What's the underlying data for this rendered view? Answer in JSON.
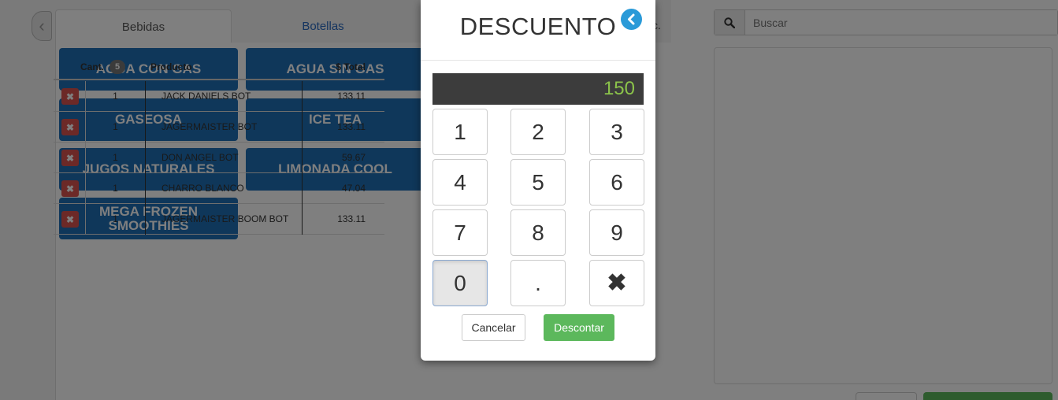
{
  "colors": {
    "product_button": "#1f6eb5",
    "delete_button": "#d9534f",
    "confirm_button": "#5cb85c",
    "display_text": "#8bc34a",
    "back_button": "#2a9ad8"
  },
  "tabs": [
    {
      "label": "Bebidas",
      "active": true
    },
    {
      "label": "Botellas",
      "active": false
    }
  ],
  "tab_overflow": "c.",
  "products": [
    {
      "label": "AGUA CON GAS"
    },
    {
      "label": "AGUA SIN GAS"
    },
    {
      "label": "GASEOSA"
    },
    {
      "label": "ICE TEA"
    },
    {
      "label": "JUGOS NATURALES"
    },
    {
      "label": "LIMONADA COOL"
    },
    {
      "label": "MEGA FROZEN SMOOTHIES"
    }
  ],
  "search": {
    "placeholder": "Buscar",
    "icon": "search-icon"
  },
  "order": {
    "headers": {
      "qty": "Cant.",
      "count": "5",
      "product": "Producto",
      "total": "$ Total"
    },
    "rows": [
      {
        "qty": "1",
        "product": "JACK DANIELS BOT",
        "total": "133.11"
      },
      {
        "qty": "1",
        "product": "JAGERMAISTER BOT",
        "total": "133.11"
      },
      {
        "qty": "1",
        "product": "DON ANGEL BOT",
        "total": "59.67"
      },
      {
        "qty": "1",
        "product": "CHARRO BLANCO",
        "total": "47.04"
      },
      {
        "qty": "1",
        "product": "JAGERMAISTER BOOM BOT",
        "total": "133.11"
      }
    ]
  },
  "modal": {
    "title": "DESCUENTO",
    "display_value": "150",
    "keys": [
      "1",
      "2",
      "3",
      "4",
      "5",
      "6",
      "7",
      "8",
      "9",
      "0",
      ".",
      "✖"
    ],
    "active_key": "0",
    "cancel_label": "Cancelar",
    "confirm_label": "Descontar"
  }
}
